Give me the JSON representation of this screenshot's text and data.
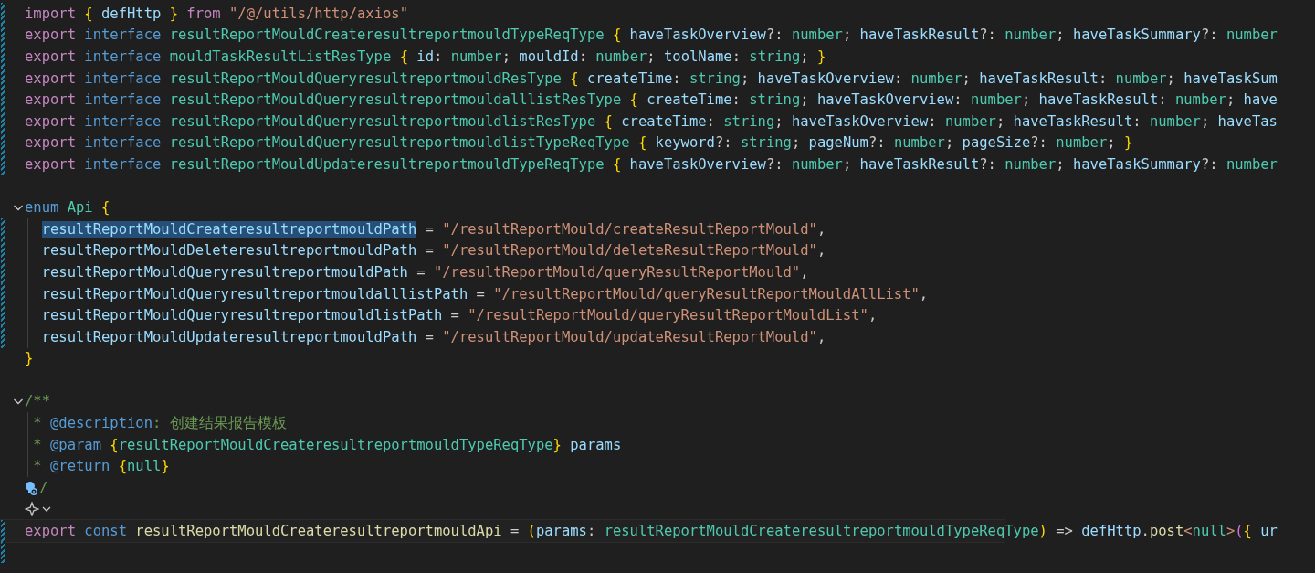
{
  "editor": {
    "lines": [
      {
        "modified": true,
        "segments": [
          {
            "kind": "keyword",
            "text": "import "
          },
          {
            "kind": "bracket",
            "text": "{"
          },
          {
            "kind": "variable",
            "text": " defHttp "
          },
          {
            "kind": "bracket",
            "text": "} "
          },
          {
            "kind": "keyword",
            "text": "from "
          },
          {
            "kind": "string",
            "text": "\"/@/utils/http/axios\""
          }
        ]
      },
      {
        "modified": true,
        "segments": [
          {
            "kind": "keyword",
            "text": "export "
          },
          {
            "kind": "storage",
            "text": "interface "
          },
          {
            "kind": "type",
            "text": "resultReportMouldCreateresultreportmouldTypeReqType "
          },
          {
            "kind": "bracket",
            "text": "{"
          },
          {
            "kind": "variable",
            "text": " haveTaskOverview"
          },
          {
            "kind": "plain",
            "text": "?: "
          },
          {
            "kind": "type",
            "text": "number"
          },
          {
            "kind": "plain",
            "text": "; "
          },
          {
            "kind": "variable",
            "text": "haveTaskResult"
          },
          {
            "kind": "plain",
            "text": "?: "
          },
          {
            "kind": "type",
            "text": "number"
          },
          {
            "kind": "plain",
            "text": "; "
          },
          {
            "kind": "variable",
            "text": "haveTaskSummary"
          },
          {
            "kind": "plain",
            "text": "?: "
          },
          {
            "kind": "type",
            "text": "number"
          }
        ]
      },
      {
        "modified": true,
        "segments": [
          {
            "kind": "keyword",
            "text": "export "
          },
          {
            "kind": "storage",
            "text": "interface "
          },
          {
            "kind": "type",
            "text": "mouldTaskResultListResType "
          },
          {
            "kind": "bracket",
            "text": "{"
          },
          {
            "kind": "variable",
            "text": " id"
          },
          {
            "kind": "plain",
            "text": ": "
          },
          {
            "kind": "type",
            "text": "number"
          },
          {
            "kind": "plain",
            "text": "; "
          },
          {
            "kind": "variable",
            "text": "mouldId"
          },
          {
            "kind": "plain",
            "text": ": "
          },
          {
            "kind": "type",
            "text": "number"
          },
          {
            "kind": "plain",
            "text": "; "
          },
          {
            "kind": "variable",
            "text": "toolName"
          },
          {
            "kind": "plain",
            "text": ": "
          },
          {
            "kind": "type",
            "text": "string"
          },
          {
            "kind": "plain",
            "text": "; "
          },
          {
            "kind": "bracket",
            "text": "}"
          }
        ]
      },
      {
        "modified": true,
        "segments": [
          {
            "kind": "keyword",
            "text": "export "
          },
          {
            "kind": "storage",
            "text": "interface "
          },
          {
            "kind": "type",
            "text": "resultReportMouldQueryresultreportmouldResType "
          },
          {
            "kind": "bracket",
            "text": "{"
          },
          {
            "kind": "variable",
            "text": " createTime"
          },
          {
            "kind": "plain",
            "text": ": "
          },
          {
            "kind": "type",
            "text": "string"
          },
          {
            "kind": "plain",
            "text": "; "
          },
          {
            "kind": "variable",
            "text": "haveTaskOverview"
          },
          {
            "kind": "plain",
            "text": ": "
          },
          {
            "kind": "type",
            "text": "number"
          },
          {
            "kind": "plain",
            "text": "; "
          },
          {
            "kind": "variable",
            "text": "haveTaskResult"
          },
          {
            "kind": "plain",
            "text": ": "
          },
          {
            "kind": "type",
            "text": "number"
          },
          {
            "kind": "plain",
            "text": "; "
          },
          {
            "kind": "variable",
            "text": "haveTaskSum"
          }
        ]
      },
      {
        "modified": true,
        "segments": [
          {
            "kind": "keyword",
            "text": "export "
          },
          {
            "kind": "storage",
            "text": "interface "
          },
          {
            "kind": "type",
            "text": "resultReportMouldQueryresultreportmouldalllistResType "
          },
          {
            "kind": "bracket",
            "text": "{"
          },
          {
            "kind": "variable",
            "text": " createTime"
          },
          {
            "kind": "plain",
            "text": ": "
          },
          {
            "kind": "type",
            "text": "string"
          },
          {
            "kind": "plain",
            "text": "; "
          },
          {
            "kind": "variable",
            "text": "haveTaskOverview"
          },
          {
            "kind": "plain",
            "text": ": "
          },
          {
            "kind": "type",
            "text": "number"
          },
          {
            "kind": "plain",
            "text": "; "
          },
          {
            "kind": "variable",
            "text": "haveTaskResult"
          },
          {
            "kind": "plain",
            "text": ": "
          },
          {
            "kind": "type",
            "text": "number"
          },
          {
            "kind": "plain",
            "text": "; "
          },
          {
            "kind": "variable",
            "text": "have"
          }
        ]
      },
      {
        "modified": true,
        "segments": [
          {
            "kind": "keyword",
            "text": "export "
          },
          {
            "kind": "storage",
            "text": "interface "
          },
          {
            "kind": "type",
            "text": "resultReportMouldQueryresultreportmouldlistResType "
          },
          {
            "kind": "bracket",
            "text": "{"
          },
          {
            "kind": "variable",
            "text": " createTime"
          },
          {
            "kind": "plain",
            "text": ": "
          },
          {
            "kind": "type",
            "text": "string"
          },
          {
            "kind": "plain",
            "text": "; "
          },
          {
            "kind": "variable",
            "text": "haveTaskOverview"
          },
          {
            "kind": "plain",
            "text": ": "
          },
          {
            "kind": "type",
            "text": "number"
          },
          {
            "kind": "plain",
            "text": "; "
          },
          {
            "kind": "variable",
            "text": "haveTaskResult"
          },
          {
            "kind": "plain",
            "text": ": "
          },
          {
            "kind": "type",
            "text": "number"
          },
          {
            "kind": "plain",
            "text": "; "
          },
          {
            "kind": "variable",
            "text": "haveTas"
          }
        ]
      },
      {
        "modified": true,
        "segments": [
          {
            "kind": "keyword",
            "text": "export "
          },
          {
            "kind": "storage",
            "text": "interface "
          },
          {
            "kind": "type",
            "text": "resultReportMouldQueryresultreportmouldlistTypeReqType "
          },
          {
            "kind": "bracket",
            "text": "{"
          },
          {
            "kind": "variable",
            "text": " keyword"
          },
          {
            "kind": "plain",
            "text": "?: "
          },
          {
            "kind": "type",
            "text": "string"
          },
          {
            "kind": "plain",
            "text": "; "
          },
          {
            "kind": "variable",
            "text": "pageNum"
          },
          {
            "kind": "plain",
            "text": "?: "
          },
          {
            "kind": "type",
            "text": "number"
          },
          {
            "kind": "plain",
            "text": "; "
          },
          {
            "kind": "variable",
            "text": "pageSize"
          },
          {
            "kind": "plain",
            "text": "?: "
          },
          {
            "kind": "type",
            "text": "number"
          },
          {
            "kind": "plain",
            "text": "; "
          },
          {
            "kind": "bracket",
            "text": "}"
          }
        ]
      },
      {
        "modified": true,
        "segments": [
          {
            "kind": "keyword",
            "text": "export "
          },
          {
            "kind": "storage",
            "text": "interface "
          },
          {
            "kind": "type",
            "text": "resultReportMouldUpdateresultreportmouldTypeReqType "
          },
          {
            "kind": "bracket",
            "text": "{"
          },
          {
            "kind": "variable",
            "text": " haveTaskOverview"
          },
          {
            "kind": "plain",
            "text": "?: "
          },
          {
            "kind": "type",
            "text": "number"
          },
          {
            "kind": "plain",
            "text": "; "
          },
          {
            "kind": "variable",
            "text": "haveTaskResult"
          },
          {
            "kind": "plain",
            "text": "?: "
          },
          {
            "kind": "type",
            "text": "number"
          },
          {
            "kind": "plain",
            "text": "; "
          },
          {
            "kind": "variable",
            "text": "haveTaskSummary"
          },
          {
            "kind": "plain",
            "text": "?: "
          },
          {
            "kind": "type",
            "text": "number"
          }
        ]
      },
      {
        "modified": false
      },
      {
        "modified": false,
        "fold": {
          "expanded": true
        },
        "segments": [
          {
            "kind": "storage",
            "text": "enum "
          },
          {
            "kind": "type",
            "text": "Api "
          },
          {
            "kind": "bracket",
            "text": "{"
          }
        ]
      },
      {
        "modified": true,
        "kind": "member",
        "segments": [
          {
            "kind": "variable",
            "text": "resultReportMouldCreateresultreportmouldPath",
            "highlighted": true
          },
          {
            "kind": "plain",
            "text": " = "
          },
          {
            "kind": "string",
            "text": "\"/resultReportMould/createResultReportMould\""
          },
          {
            "kind": "plain",
            "text": ","
          }
        ]
      },
      {
        "modified": true,
        "kind": "member",
        "segments": [
          {
            "kind": "variable",
            "text": "resultReportMouldDeleteresultreportmouldPath"
          },
          {
            "kind": "plain",
            "text": " = "
          },
          {
            "kind": "string",
            "text": "\"/resultReportMould/deleteResultReportMould\""
          },
          {
            "kind": "plain",
            "text": ","
          }
        ]
      },
      {
        "modified": true,
        "kind": "member",
        "segments": [
          {
            "kind": "variable",
            "text": "resultReportMouldQueryresultreportmouldPath"
          },
          {
            "kind": "plain",
            "text": " = "
          },
          {
            "kind": "string",
            "text": "\"/resultReportMould/queryResultReportMould\""
          },
          {
            "kind": "plain",
            "text": ","
          }
        ]
      },
      {
        "modified": true,
        "kind": "member",
        "segments": [
          {
            "kind": "variable",
            "text": "resultReportMouldQueryresultreportmouldalllistPath"
          },
          {
            "kind": "plain",
            "text": " = "
          },
          {
            "kind": "string",
            "text": "\"/resultReportMould/queryResultReportMouldAllList\""
          },
          {
            "kind": "plain",
            "text": ","
          }
        ]
      },
      {
        "modified": true,
        "kind": "member",
        "segments": [
          {
            "kind": "variable",
            "text": "resultReportMouldQueryresultreportmouldlistPath"
          },
          {
            "kind": "plain",
            "text": " = "
          },
          {
            "kind": "string",
            "text": "\"/resultReportMould/queryResultReportMouldList\""
          },
          {
            "kind": "plain",
            "text": ","
          }
        ]
      },
      {
        "modified": true,
        "kind": "member",
        "segments": [
          {
            "kind": "variable",
            "text": "resultReportMouldUpdateresultreportmouldPath"
          },
          {
            "kind": "plain",
            "text": " = "
          },
          {
            "kind": "string",
            "text": "\"/resultReportMould/updateResultReportMould\""
          },
          {
            "kind": "plain",
            "text": ","
          }
        ]
      },
      {
        "modified": false,
        "segments": [
          {
            "kind": "bracket",
            "text": "}"
          }
        ]
      },
      {
        "modified": false
      },
      {
        "modified": false,
        "fold": {
          "expanded": true
        },
        "segments": [
          {
            "kind": "comment",
            "text": "/**"
          }
        ]
      },
      {
        "modified": false,
        "segments": [
          {
            "kind": "comment",
            "text": " * "
          },
          {
            "kind": "tag",
            "text": "@description"
          },
          {
            "kind": "comment",
            "text": ": 创建结果报告模板"
          }
        ]
      },
      {
        "modified": false,
        "segments": [
          {
            "kind": "comment",
            "text": " * "
          },
          {
            "kind": "tag",
            "text": "@param "
          },
          {
            "kind": "bracket",
            "text": "{"
          },
          {
            "kind": "type",
            "text": "resultReportMouldCreateresultreportmouldTypeReqType"
          },
          {
            "kind": "bracket",
            "text": "} "
          },
          {
            "kind": "variable",
            "text": "params"
          }
        ]
      },
      {
        "modified": false,
        "segments": [
          {
            "kind": "comment",
            "text": " * "
          },
          {
            "kind": "tag",
            "text": "@return "
          },
          {
            "kind": "bracket",
            "text": "{"
          },
          {
            "kind": "type",
            "text": "null"
          },
          {
            "kind": "bracket",
            "text": "}"
          }
        ]
      },
      {
        "modified": false,
        "kind": "hint",
        "segments": [
          {
            "kind": "comment",
            "text": "/"
          }
        ]
      },
      {
        "modified": false,
        "kind": "action"
      },
      {
        "modified": true,
        "current": true,
        "segments": [
          {
            "kind": "keyword",
            "text": "export "
          },
          {
            "kind": "storage",
            "text": "const "
          },
          {
            "kind": "function",
            "text": "resultReportMouldCreateresultreportmouldApi"
          },
          {
            "kind": "plain",
            "text": " = "
          },
          {
            "kind": "bracket",
            "text": "("
          },
          {
            "kind": "variable",
            "text": "params"
          },
          {
            "kind": "plain",
            "text": ": "
          },
          {
            "kind": "type",
            "text": "resultReportMouldCreateresultreportmouldTypeReqType"
          },
          {
            "kind": "bracket",
            "text": ")"
          },
          {
            "kind": "plain",
            "text": " => "
          },
          {
            "kind": "variable",
            "text": "defHttp"
          },
          {
            "kind": "plain",
            "text": "."
          },
          {
            "kind": "function",
            "text": "post"
          },
          {
            "kind": "bracket2",
            "text": "<"
          },
          {
            "kind": "type",
            "text": "null"
          },
          {
            "kind": "bracket2",
            "text": ">"
          },
          {
            "kind": "bracket3",
            "text": "("
          },
          {
            "kind": "bracket",
            "text": "{"
          },
          {
            "kind": "variable",
            "text": " ur"
          }
        ]
      },
      {
        "modified": true
      }
    ]
  }
}
